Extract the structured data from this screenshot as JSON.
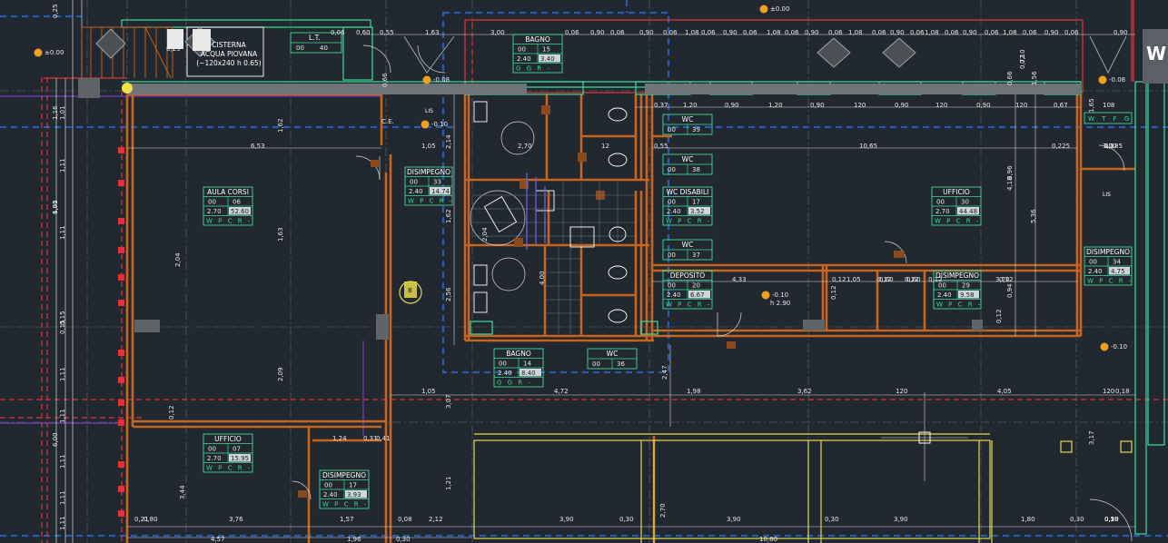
{
  "colors": {
    "background": "#212830",
    "wall": "#c8641e",
    "green": "#3ddc97",
    "yellow": "#e6d84a",
    "red": "#e0323c",
    "blue": "#2a5db0",
    "dim": "#d8d8d8"
  },
  "title_badge": "W",
  "notes": {
    "cistern_line1": "CISTERNA",
    "cistern_line2": "ACQUA PIOVANA",
    "cistern_line3": "(~120x240 h 0.65)",
    "cistern_dim_1": "0,25",
    "cistern_dim_2": "1,25",
    "lt": "L.T.",
    "lt_a": "00",
    "lt_b": "40",
    "ce": "C.E.",
    "lis1": "LIS",
    "lis2": "LIS",
    "marker": "B"
  },
  "levels": {
    "top": "±0.00",
    "left": "±0.00",
    "entry1": "-0.08",
    "entry2": "-0.08",
    "ce_level": "-0.10",
    "right": "-0.10",
    "dep_1": "-0.10",
    "dep_2": "h 2.90"
  },
  "rooms": {
    "bagno_top": {
      "name": "BAGNO",
      "a": "00",
      "b": "15",
      "c": "2.40",
      "d": "3.40",
      "row": "G G R -"
    },
    "wc1": {
      "name": "WC",
      "a": "00",
      "b": "39"
    },
    "wc2": {
      "name": "WC",
      "a": "00",
      "b": "38"
    },
    "wc_disabili": {
      "name": "WC DISABILI",
      "a": "00",
      "b": "17",
      "c": "2.40",
      "d": "3.52",
      "row": "W P C R -"
    },
    "wc3": {
      "name": "WC",
      "a": "00",
      "b": "37"
    },
    "deposito": {
      "name": "DEPOSITO",
      "a": "00",
      "b": "20",
      "c": "2.40",
      "d": "6.67",
      "row": "W P C R -"
    },
    "disimpegno1": {
      "name": "DISIMPEGNO",
      "a": "00",
      "b": "33",
      "c": "2.40",
      "d": "14.74",
      "row": "W P C R -"
    },
    "aula": {
      "name": "AULA CORSI",
      "a": "00",
      "b": "06",
      "c": "2.70",
      "d": "52.60",
      "row": "W P C R -"
    },
    "ufficio_r": {
      "name": "UFFICIO",
      "a": "00",
      "b": "30",
      "c": "2.70",
      "d": "44.48",
      "row": "W P C R -"
    },
    "disimpegno2": {
      "name": "DISIMPEGNO",
      "a": "00",
      "b": "34",
      "c": "2.40",
      "d": "4.75",
      "row": "W P C R -"
    },
    "disimpegno3": {
      "name": "DISIMPEGNO",
      "a": "00",
      "b": "29",
      "c": "2.40",
      "d": "9.58",
      "row": "W P C R -"
    },
    "bagno_bot": {
      "name": "BAGNO",
      "a": "00",
      "b": "14",
      "c": "2.40",
      "d": "8.40",
      "row": "G G R -"
    },
    "wc4": {
      "name": "WC",
      "a": "00",
      "b": "36"
    },
    "ufficio_l": {
      "name": "UFFICIO",
      "a": "00",
      "b": "07",
      "c": "2.70",
      "d": "15.95",
      "row": "W P C R -"
    },
    "disimpegno4": {
      "name": "DISIMPEGNO",
      "a": "00",
      "b": "17",
      "c": "2.40",
      "d": "3.93",
      "row": "W P C R -"
    },
    "wtfg": {
      "row": "W T F G"
    }
  },
  "dims_top": [
    "0,06",
    "0,60",
    "0,55",
    "1,63",
    "3,00",
    "0,06",
    "0,90",
    "0,06",
    "0,90",
    "0,06",
    "1,08",
    "0,06",
    "0,90",
    "0,06",
    "1,08",
    "0,06",
    "0,90",
    "0,06",
    "1,08",
    "0,06",
    "0,90",
    "0,06",
    "1,08",
    "0,06",
    "0,90",
    "0,06",
    "1,08",
    "0,06",
    "0,90",
    "0,06",
    "0,90"
  ],
  "dims_row2": [
    "0,37",
    "1,20",
    "0,90",
    "1,20",
    "0,90",
    "120",
    "0,90",
    "120",
    "0,90",
    "120",
    "0,67",
    "108"
  ],
  "dims_mid": [
    "6,53",
    "1,05",
    "2,70",
    "12",
    "0,55",
    "10,65",
    "0,225",
    "0,185",
    "12",
    "1,00"
  ],
  "dims_lower": [
    "4,33",
    "1,05",
    "0,60",
    "0,60",
    "3,70",
    "0,12",
    "0,12",
    "0,12",
    "0,12",
    "0,12"
  ],
  "dims_row3": [
    "1,05",
    "4,72",
    "1,98",
    "3,62",
    "120",
    "4,05",
    "120",
    "0,18"
  ],
  "dims_bottom": [
    "0,21",
    "0,80",
    "3,76",
    "1,57",
    "0,08",
    "2,12",
    "3,90",
    "0,30",
    "3,90",
    "0,30",
    "3,90",
    "1,80",
    "0,30",
    "0,50",
    "0,18",
    "0,30",
    "0,20"
  ],
  "dims_bottom2": [
    "4,57",
    "1,96",
    "0,30",
    "10,80"
  ],
  "dims_small": [
    "1,24",
    "0,31",
    "0,41"
  ],
  "dims_vert": [
    "0,25",
    "1,16",
    "1,62",
    "2,14",
    "1,62",
    "2,56",
    "2,04",
    "1,91",
    "1,63",
    "2,09",
    "3,44",
    "1,21",
    "0,12",
    "5,36",
    "0,94",
    "4,18",
    "0,12",
    "0,96",
    "0,15",
    "2,47",
    "3,07",
    "2,70",
    "3,17",
    "0,66",
    "0,10",
    "1,56",
    "0,66",
    "1,65",
    "0,72",
    "0,12",
    "2,04",
    "4,00"
  ],
  "dims_leftcol": [
    "6,00",
    "1,01",
    "1,11",
    "1,11",
    "6,00",
    "1,11",
    "1,11",
    "1,11",
    "1,11",
    "1,11",
    "0,15"
  ]
}
